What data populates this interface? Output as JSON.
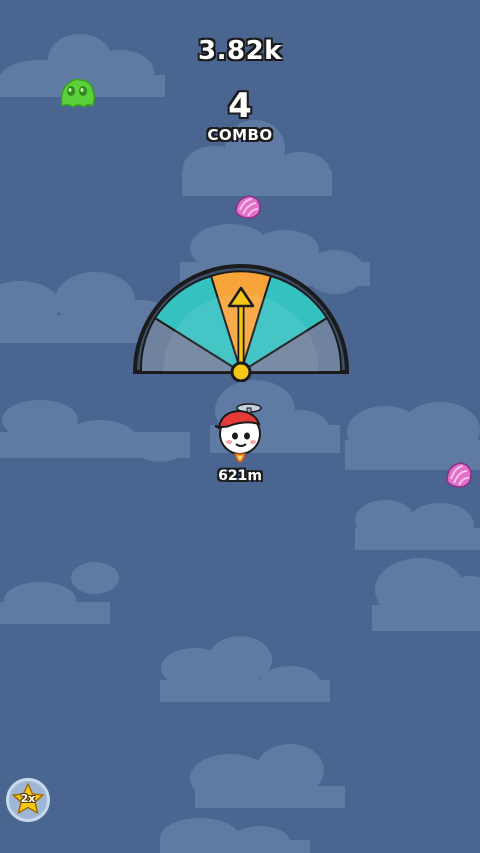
{
  "hud": {
    "score": "3.82k",
    "combo_count": "4",
    "combo_label": "COMBO"
  },
  "player": {
    "distance": "621m"
  },
  "powerup": {
    "label": "2x"
  },
  "gauge": {
    "segments": [
      "red",
      "teal",
      "orange",
      "teal",
      "red"
    ],
    "needle_position": "center"
  },
  "colors": {
    "sky": "#4a6590",
    "cloud": "#6a85ad",
    "gauge_teal": "#36c1c1",
    "gauge_orange": "#f7a43a",
    "needle": "#f5c816",
    "slime": "#5ad13a",
    "shell": "#e36fc9"
  },
  "icons": [
    "slime-enemy-icon",
    "candy-shell-icon",
    "player-character-icon",
    "star-boost-icon"
  ]
}
